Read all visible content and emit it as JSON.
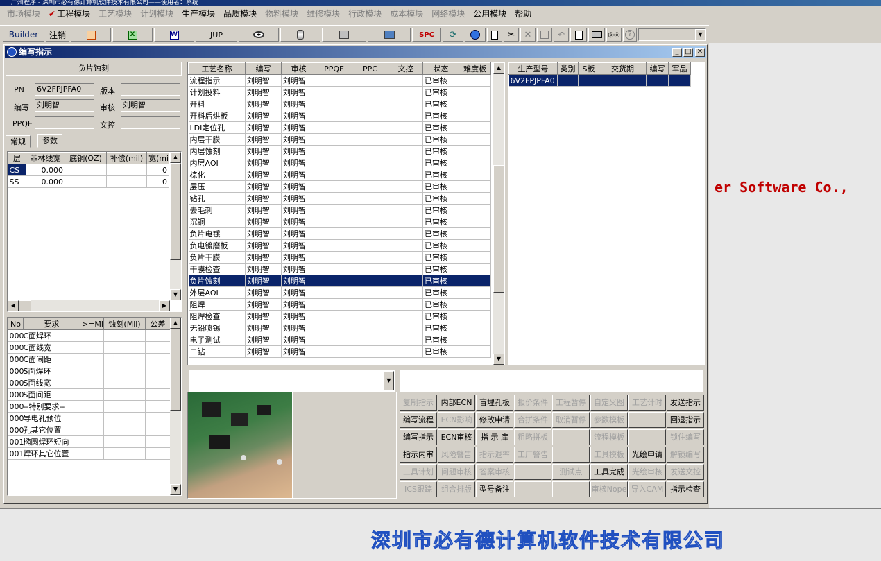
{
  "app": {
    "title": "广州程序 - 深圳市必有德计算机软件技术有限公司——使用者：系统"
  },
  "menu": [
    {
      "label": "市场模块",
      "on": false
    },
    {
      "label": "工程模块",
      "on": true,
      "checked": true
    },
    {
      "label": "工艺模块",
      "on": false
    },
    {
      "label": "计划模块",
      "on": false
    },
    {
      "label": "生产模块",
      "on": true
    },
    {
      "label": "品质模块",
      "on": true
    },
    {
      "label": "物料模块",
      "on": false
    },
    {
      "label": "维修模块",
      "on": false
    },
    {
      "label": "行政模块",
      "on": false
    },
    {
      "label": "成本模块",
      "on": false
    },
    {
      "label": "网络模块",
      "on": false
    },
    {
      "label": "公用模块",
      "on": true
    },
    {
      "label": "帮助",
      "on": true
    }
  ],
  "toolbar": {
    "builder": "Builder",
    "logout": "注销",
    "jup": "JUP",
    "spc": "SPC"
  },
  "window": {
    "title": "编写指示"
  },
  "form": {
    "process_name": "负片蚀刻",
    "pn_label": "PN",
    "pn_value": "6V2FPJPFA0",
    "version_label": "版本",
    "version_value": "",
    "author_label": "编写",
    "author_value": "刘明智",
    "reviewer_label": "审核",
    "reviewer_value": "刘明智",
    "ppqe_label": "PPQE",
    "ppqe_value": "",
    "wenkong_label": "文控",
    "wenkong_value": ""
  },
  "tabs": [
    {
      "label": "常规"
    },
    {
      "label": "参数"
    }
  ],
  "param_table": {
    "headers": [
      "层",
      "菲林线宽",
      "底铜(OZ)",
      "补偿(mil)",
      "宽(mil)"
    ],
    "rows": [
      {
        "layer": "CS",
        "width": "0.000",
        "copper": "",
        "comp": "",
        "w": "0"
      },
      {
        "layer": "SS",
        "width": "0.000",
        "copper": "",
        "comp": "",
        "w": "0"
      }
    ]
  },
  "req_table": {
    "headers": [
      "No",
      "要求",
      ">=Mil",
      "蚀刻(Mil)",
      "公差"
    ],
    "rows": [
      {
        "no": "000",
        "req": "C面焊环"
      },
      {
        "no": "000",
        "req": "C面线宽"
      },
      {
        "no": "000",
        "req": "C面间距"
      },
      {
        "no": "000",
        "req": "S面焊环"
      },
      {
        "no": "000",
        "req": "S面线宽"
      },
      {
        "no": "000",
        "req": "S面间距"
      },
      {
        "no": "000",
        "req": "--特别要求--"
      },
      {
        "no": "000",
        "req": "导电孔预位"
      },
      {
        "no": "000",
        "req": "孔其它位置"
      },
      {
        "no": "001",
        "req": "椭圆焊环短向"
      },
      {
        "no": "001",
        "req": "焊环其它位置"
      }
    ]
  },
  "process_table": {
    "headers": [
      "工艺名称",
      "编写",
      "审核",
      "PPQE",
      "PPC",
      "文控",
      "状态",
      "难度板"
    ],
    "rows": [
      {
        "name": "流程指示",
        "author": "刘明智",
        "reviewer": "刘明智",
        "status": "已审核"
      },
      {
        "name": "计划投料",
        "author": "刘明智",
        "reviewer": "刘明智",
        "status": "已审核"
      },
      {
        "name": "开料",
        "author": "刘明智",
        "reviewer": "刘明智",
        "status": "已审核"
      },
      {
        "name": "开料后烘板",
        "author": "刘明智",
        "reviewer": "刘明智",
        "status": "已审核"
      },
      {
        "name": "LDI定位孔",
        "author": "刘明智",
        "reviewer": "刘明智",
        "status": "已审核"
      },
      {
        "name": "内层干膜",
        "author": "刘明智",
        "reviewer": "刘明智",
        "status": "已审核"
      },
      {
        "name": "内层蚀刻",
        "author": "刘明智",
        "reviewer": "刘明智",
        "status": "已审核"
      },
      {
        "name": "内层AOI",
        "author": "刘明智",
        "reviewer": "刘明智",
        "status": "已审核"
      },
      {
        "name": "棕化",
        "author": "刘明智",
        "reviewer": "刘明智",
        "status": "已审核"
      },
      {
        "name": "层压",
        "author": "刘明智",
        "reviewer": "刘明智",
        "status": "已审核"
      },
      {
        "name": "钻孔",
        "author": "刘明智",
        "reviewer": "刘明智",
        "status": "已审核"
      },
      {
        "name": "去毛刺",
        "author": "刘明智",
        "reviewer": "刘明智",
        "status": "已审核"
      },
      {
        "name": "沉铜",
        "author": "刘明智",
        "reviewer": "刘明智",
        "status": "已审核"
      },
      {
        "name": "负片电镀",
        "author": "刘明智",
        "reviewer": "刘明智",
        "status": "已审核"
      },
      {
        "name": "负电镀磨板",
        "author": "刘明智",
        "reviewer": "刘明智",
        "status": "已审核"
      },
      {
        "name": "负片干膜",
        "author": "刘明智",
        "reviewer": "刘明智",
        "status": "已审核"
      },
      {
        "name": "干膜检查",
        "author": "刘明智",
        "reviewer": "刘明智",
        "status": "已审核"
      },
      {
        "name": "负片蚀刻",
        "author": "刘明智",
        "reviewer": "刘明智",
        "status": "已审核",
        "selected": true
      },
      {
        "name": "外层AOI",
        "author": "刘明智",
        "reviewer": "刘明智",
        "status": "已审核"
      },
      {
        "name": "阻焊",
        "author": "刘明智",
        "reviewer": "刘明智",
        "status": "已审核"
      },
      {
        "name": "阻焊检查",
        "author": "刘明智",
        "reviewer": "刘明智",
        "status": "已审核"
      },
      {
        "name": "无铅喷锡",
        "author": "刘明智",
        "reviewer": "刘明智",
        "status": "已审核"
      },
      {
        "name": "电子测试",
        "author": "刘明智",
        "reviewer": "刘明智",
        "status": "已审核"
      },
      {
        "name": "二钻",
        "author": "刘明智",
        "reviewer": "刘明智",
        "status": "已审核"
      }
    ]
  },
  "model_table": {
    "headers": [
      "生产型号",
      "类别",
      "S板",
      "交货期",
      "编写",
      "军品"
    ],
    "rows": [
      {
        "model": "6V2FPJPFA0",
        "type": "",
        "s": "",
        "due": "",
        "author": "",
        "mil": ""
      }
    ]
  },
  "actions": [
    [
      "复制指示",
      "内部ECN",
      "盲埋孔板",
      "报价条件",
      "工程暂停",
      "自定义图",
      "工艺计时",
      "发送指示"
    ],
    [
      "编写流程",
      "ECN影响",
      "修改申请",
      "合拼条件",
      "取消暂停",
      "参数模板",
      "",
      "回退指示"
    ],
    [
      "编写指示",
      "ECN审核",
      "指 示 库",
      "粗略拼板",
      "",
      "流程模板",
      "",
      "锁住编写"
    ],
    [
      "指示内审",
      "风险警告",
      "指示退率",
      "工厂警告",
      "",
      "工具模板",
      "光绘申请",
      "解锁编写"
    ],
    [
      "工具计划",
      "问题审核",
      "答案审核",
      "",
      "测试点",
      "工具完成",
      "光绘审核",
      "发送文控"
    ],
    [
      "ICS跟踪",
      "组合排版",
      "型号备注",
      "",
      "",
      "审核Nope",
      "导入CAM",
      "指示检查"
    ]
  ],
  "actions_enabled": [
    [
      false,
      true,
      true,
      false,
      false,
      false,
      false,
      true
    ],
    [
      true,
      false,
      true,
      false,
      false,
      false,
      false,
      true
    ],
    [
      true,
      true,
      true,
      false,
      false,
      false,
      false,
      false
    ],
    [
      true,
      false,
      false,
      false,
      false,
      false,
      true,
      false
    ],
    [
      false,
      false,
      false,
      false,
      false,
      true,
      false,
      false
    ],
    [
      false,
      false,
      true,
      false,
      false,
      false,
      false,
      true
    ]
  ],
  "background": {
    "company_en": "er Software Co.,",
    "company_cn": "深圳市必有德计算机软件技术有限公司"
  },
  "colors": {
    "title": "#0a246a",
    "selection": "#0a246a",
    "accent_red": "#c00000",
    "footer": "#2050c0"
  }
}
